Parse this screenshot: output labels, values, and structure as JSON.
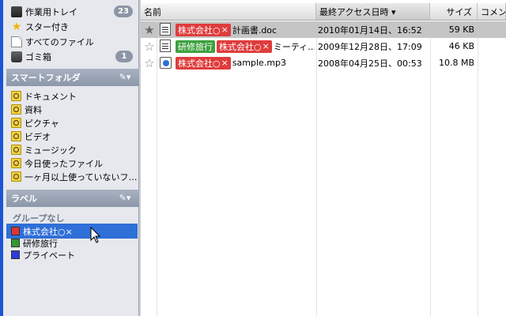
{
  "sidebar": {
    "nav": [
      {
        "label": "作業用トレイ",
        "icon": "inbox-icon",
        "count": "23"
      },
      {
        "label": "スター付き",
        "icon": "star-icon"
      },
      {
        "label": "すべてのファイル",
        "icon": "document-icon"
      },
      {
        "label": "ゴミ箱",
        "icon": "trash-icon",
        "count": "1"
      }
    ],
    "smart_folders": {
      "title": "スマートフォルダ",
      "edit_icon": "✎▾",
      "items": [
        {
          "label": "ドキュメント"
        },
        {
          "label": "資料"
        },
        {
          "label": "ピクチャ"
        },
        {
          "label": "ビデオ"
        },
        {
          "label": "ミュージック"
        },
        {
          "label": "今日使ったファイル"
        },
        {
          "label": "一ヶ月以上使っていないフ…"
        }
      ]
    },
    "labels": {
      "title": "ラベル",
      "edit_icon": "✎▾",
      "group": "グループなし",
      "items": [
        {
          "label": "株式会社○×",
          "color": "#e03535",
          "selected": true
        },
        {
          "label": "研修旅行",
          "color": "#2f9a2f"
        },
        {
          "label": "プライベート",
          "color": "#2b3bdc"
        }
      ]
    }
  },
  "table": {
    "columns": {
      "name": "名前",
      "date": "最終アクセス日時 ▾",
      "size": "サイズ",
      "comment": "コメント"
    },
    "rows": [
      {
        "starred": "★",
        "icon": "word-document-icon",
        "tags": [
          {
            "text": "株式会社○",
            "x": "×",
            "color": "red"
          }
        ],
        "name": "計画書.doc",
        "date": "2010年01月14日、16:52",
        "size": "59 KB"
      },
      {
        "starred": "☆",
        "icon": "document-icon",
        "tags": [
          {
            "text": "研修旅行",
            "color": "green"
          },
          {
            "text": "株式会社○",
            "x": "×",
            "color": "red"
          }
        ],
        "name": "ミーティ…",
        "date": "2009年12月28日、17:09",
        "size": "46 KB"
      },
      {
        "starred": "☆",
        "icon": "audio-file-icon",
        "tags": [
          {
            "text": "株式会社○",
            "x": "×",
            "color": "red"
          }
        ],
        "name": "sample.mp3",
        "date": "2008年04月25日、00:53",
        "size": "10.8 MB"
      }
    ]
  }
}
